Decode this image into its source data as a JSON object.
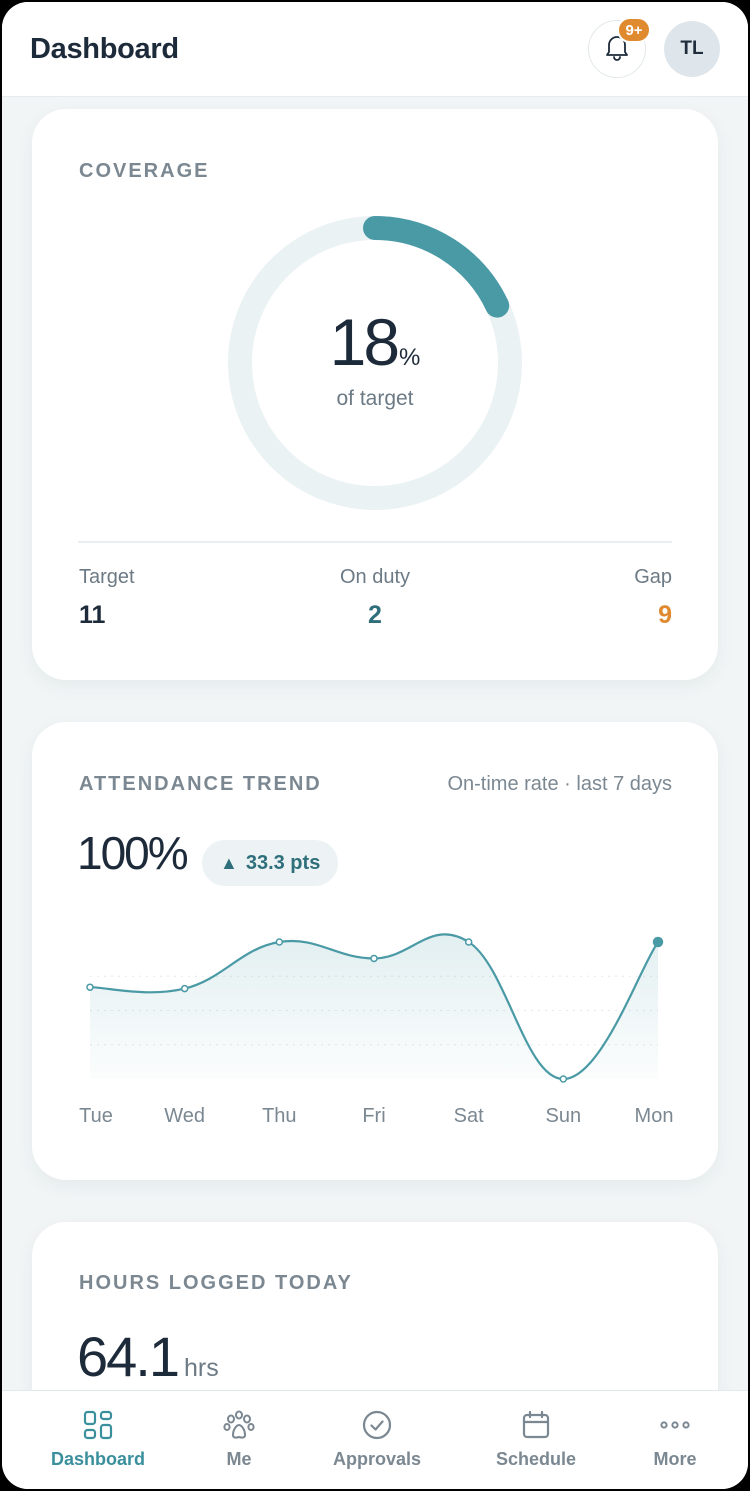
{
  "header": {
    "title": "Dashboard",
    "notification_badge": "9+",
    "avatar_initials": "TL"
  },
  "coverage": {
    "label": "COVERAGE",
    "percent": 18,
    "percent_text": "18",
    "percent_symbol": "%",
    "caption": "of target",
    "stats": [
      {
        "label": "Target",
        "value": "11",
        "color": "#1d2a3a"
      },
      {
        "label": "On duty",
        "value": "2",
        "color": "#2f6f7b"
      },
      {
        "label": "Gap",
        "value": "9",
        "color": "#e08a2f"
      }
    ]
  },
  "attendance": {
    "label": "ATTENDANCE TREND",
    "subtitle": "On-time rate · last 7 days",
    "value": "100%",
    "delta": "33.3 pts",
    "delta_icon": "triangle-up"
  },
  "chart_data": {
    "type": "area",
    "title": "ATTENDANCE TREND",
    "subtitle": "On-time rate · last 7 days",
    "categories": [
      "Tue",
      "Wed",
      "Thu",
      "Fri",
      "Sat",
      "Sun",
      "Mon"
    ],
    "series": [
      {
        "values": [
          67,
          66,
          100,
          88,
          100,
          0,
          100
        ]
      }
    ],
    "ylim": [
      0,
      100
    ],
    "grid": true,
    "accent": "#4a9aa6"
  },
  "hours": {
    "label": "HOURS LOGGED TODAY",
    "value": "64.1",
    "unit": "hrs"
  },
  "nav": {
    "items": [
      {
        "label": "Dashboard",
        "icon": "grid-icon",
        "active": true
      },
      {
        "label": "Me",
        "icon": "paw-icon",
        "active": false
      },
      {
        "label": "Approvals",
        "icon": "check-circle-icon",
        "active": false
      },
      {
        "label": "Schedule",
        "icon": "calendar-icon",
        "active": false
      },
      {
        "label": "More",
        "icon": "more-dots-icon",
        "active": false
      }
    ]
  },
  "colors": {
    "accent": "#4a9aa6",
    "warning": "#e08a2f",
    "track": "#ebf2f4"
  }
}
